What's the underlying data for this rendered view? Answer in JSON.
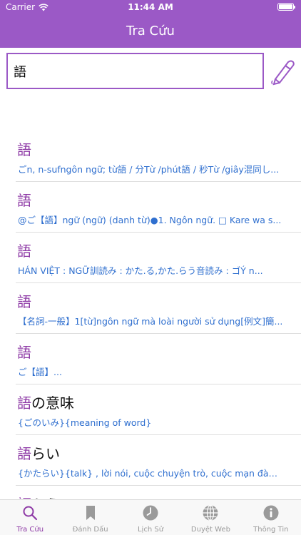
{
  "status_bar": {
    "carrier": "Carrier",
    "time": "11:44 AM"
  },
  "nav": {
    "title": "Tra Cứu"
  },
  "search": {
    "query": "語"
  },
  "results": [
    {
      "word": "語",
      "tail": "",
      "desc": "ごn, n-sufngôn ngữ; từ語 / 分Từ /phút語 / 秒Từ /giây混同し..."
    },
    {
      "word": "語",
      "tail": "",
      "desc": "@ご【語】ngữ (ngữ)   (danh từ)●1. Ngôn ngữ.   □ Kare wa s..."
    },
    {
      "word": "語",
      "tail": "",
      "desc": "HÁN VIỆT : NGỮ訓読み   : かた.る,かた.らう音読み   : ゴÝ n..."
    },
    {
      "word": "語",
      "tail": "",
      "desc": "【名詞-一般】1[từ]ngôn ngữ mà loài người sử dụng[例文]簡..."
    },
    {
      "word": "語",
      "tail": "",
      "desc": "ご【語】..."
    },
    {
      "word": "語",
      "tail": "の意味",
      "desc": "{ごのいみ}{meaning of word}"
    },
    {
      "word": "語",
      "tail": "らい",
      "desc": "{かたらい}{talk} , lời nói, cuộc chuyện trò, cuộc mạn đàm, bà..."
    },
    {
      "word": "語",
      "tail": "らう",
      "desc": ""
    }
  ],
  "tabs": [
    {
      "label": "Tra Cứu",
      "icon": "search-icon",
      "active": true
    },
    {
      "label": "Đánh Dấu",
      "icon": "bookmark-icon",
      "active": false
    },
    {
      "label": "Lịch Sử",
      "icon": "clock-icon",
      "active": false
    },
    {
      "label": "Duyệt Web",
      "icon": "globe-icon",
      "active": false
    },
    {
      "label": "Thông Tin",
      "icon": "info-icon",
      "active": false
    }
  ],
  "colors": {
    "accent": "#9b59c6",
    "word": "#8e3aa6",
    "link": "#2f6fcf"
  }
}
